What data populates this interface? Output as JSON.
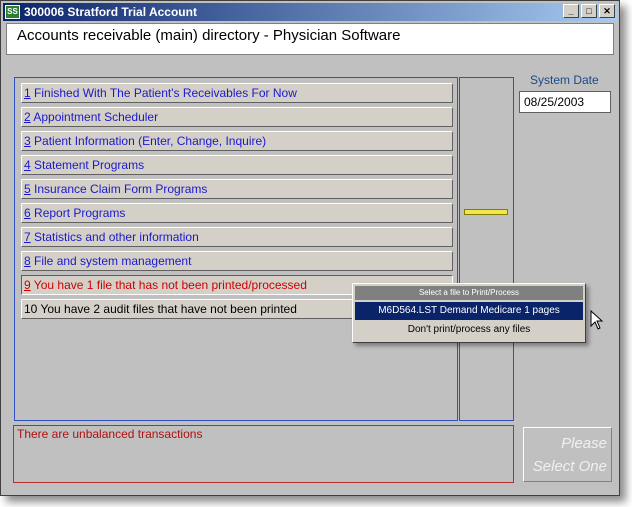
{
  "window": {
    "title": "300006 Stratford Trial Account",
    "icon": "app-icon"
  },
  "header": {
    "title": "Accounts receivable (main) directory - Physician Software"
  },
  "menu": {
    "items": [
      {
        "num": "1",
        "label": " Finished With The Patient's Receivables For Now"
      },
      {
        "num": "2",
        "label": " Appointment Scheduler"
      },
      {
        "num": "3",
        "label": " Patient Information (Enter, Change, Inquire)"
      },
      {
        "num": "4",
        "label": " Statement Programs"
      },
      {
        "num": "5",
        "label": " Insurance Claim Form Programs"
      },
      {
        "num": "6",
        "label": " Report Programs"
      },
      {
        "num": "7",
        "label": " Statistics and other information"
      },
      {
        "num": "8",
        "label": " File and system management"
      },
      {
        "num": "9",
        "label": " You have 1 file that has not been printed/processed"
      },
      {
        "num": "10",
        "label": " You have 2 audit files that have not been printed"
      }
    ]
  },
  "system_date": {
    "label": "System Date",
    "value": "08/25/2003"
  },
  "status": {
    "message": "There are unbalanced transactions"
  },
  "select_button": {
    "line1": "Please",
    "line2": "Select One"
  },
  "popup": {
    "title": "Select a file to Print/Process",
    "options": [
      {
        "label": "M6D564.LST Demand Medicare 1 pages"
      },
      {
        "label": "Don't print/process any files"
      }
    ]
  },
  "colors": {
    "menu_text": "#1a1acc",
    "alert_text": "#d00000",
    "title_bar": "#0a246a",
    "indicator": "#f2e64a"
  }
}
